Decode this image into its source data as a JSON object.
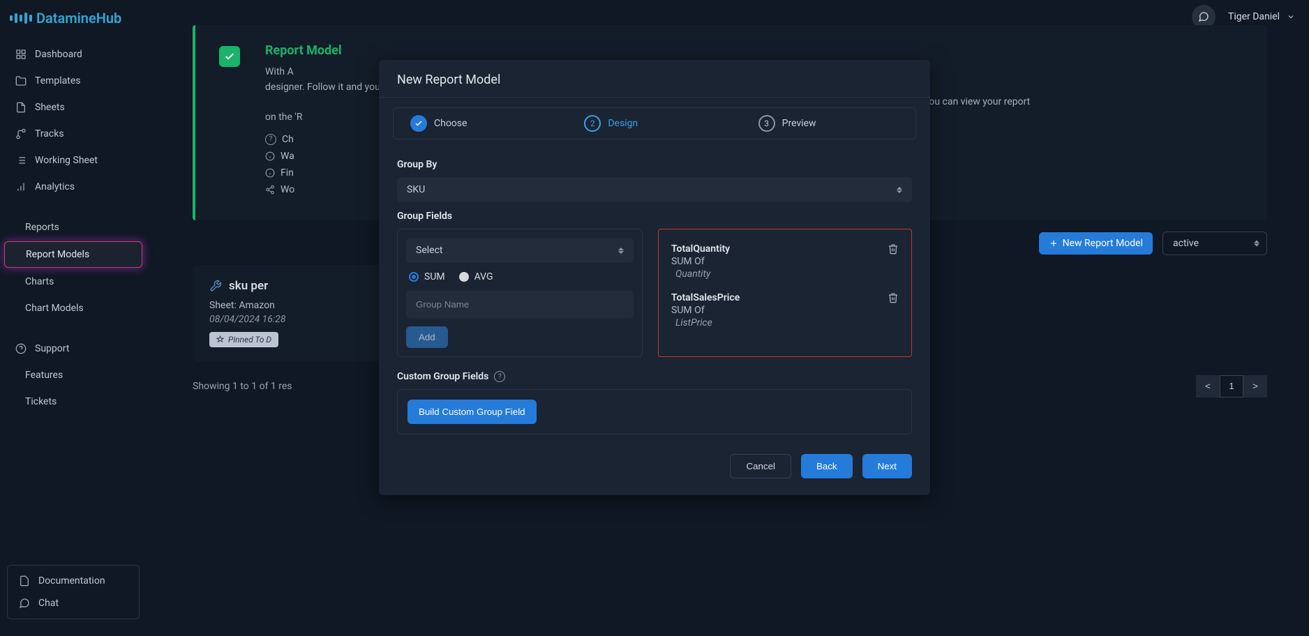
{
  "brand": "DatamineHub",
  "user": {
    "name": "Tiger Daniel"
  },
  "sidebar": {
    "items": {
      "dashboard": "Dashboard",
      "templates": "Templates",
      "sheets": "Sheets",
      "tracks": "Tracks",
      "workingSheet": "Working Sheet",
      "analytics": "Analytics",
      "reports": "Reports",
      "reportModels": "Report Models",
      "charts": "Charts",
      "chartModels": "Chart Models",
      "support": "Support",
      "features": "Features",
      "tickets": "Tickets",
      "documentation": "Documentation",
      "chat": "Chat"
    }
  },
  "greenCard": {
    "title": "Report Model",
    "descStart": "With A",
    "descEnd": "designer. Follow it and you will get any possible report",
    "descEnd2": "designed the model, you can view your report on the 'R",
    "list": {
      "i1": "Ch",
      "i2": "Wa",
      "i3": "Fin",
      "i4": "Wo"
    }
  },
  "toolbar": {
    "newReportModel": "New Report Model",
    "status": "active"
  },
  "modelCard": {
    "title": "sku per",
    "sheetPrefix": "Sheet: ",
    "sheet": "Amazon",
    "date": "08/04/2024 16:28",
    "pinned": "Pinned To D"
  },
  "results": {
    "text": "Showing 1 to 1 of 1 res",
    "prev": "<",
    "page": "1",
    "next": ">"
  },
  "modal": {
    "title": "New Report Model",
    "steps": {
      "s1": "Choose",
      "s2": "Design",
      "s3": "Preview",
      "n2": "2",
      "n3": "3"
    },
    "groupByLabel": "Group By",
    "groupByValue": "SKU",
    "groupFieldsLabel": "Group Fields",
    "selectPlaceholder": "Select",
    "sum": "SUM",
    "avg": "AVG",
    "groupNamePlaceholder": "Group Name",
    "add": "Add",
    "items": [
      {
        "name": "TotalQuantity",
        "agg": "SUM Of",
        "field": "Quantity"
      },
      {
        "name": "TotalSalesPrice",
        "agg": "SUM Of",
        "field": "ListPrice"
      }
    ],
    "customLabel": "Custom Group Fields",
    "buildCustom": "Build Custom Group Field",
    "cancel": "Cancel",
    "back": "Back",
    "next": "Next"
  }
}
